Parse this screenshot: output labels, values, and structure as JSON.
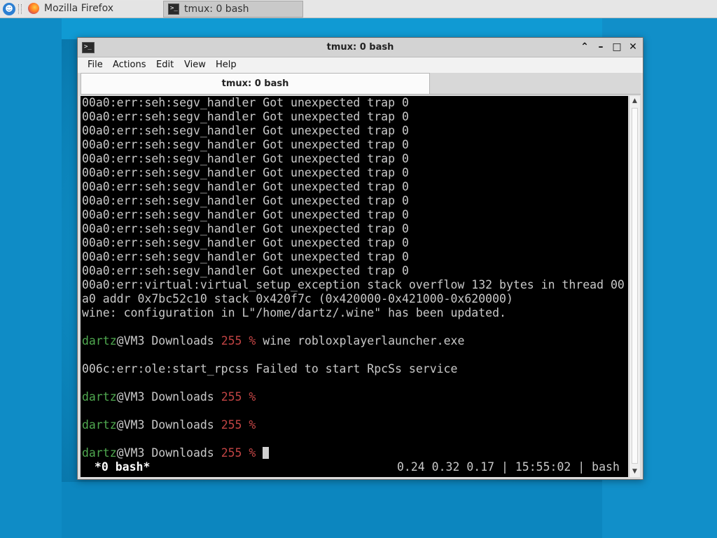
{
  "taskbar": {
    "tasks": [
      {
        "label": "Mozilla Firefox",
        "icon": "firefox-icon"
      },
      {
        "label": "tmux: 0 bash",
        "icon": "terminal-icon"
      }
    ]
  },
  "window": {
    "title": "tmux: 0 bash",
    "controls": [
      "maximize-up",
      "minimize",
      "maximize",
      "close"
    ],
    "menu": [
      "File",
      "Actions",
      "Edit",
      "View",
      "Help"
    ],
    "tab_label": "tmux: 0 bash"
  },
  "terminal": {
    "lines": [
      {
        "text": "00a0:err:seh:segv_handler Got unexpected trap 0"
      },
      {
        "text": "00a0:err:seh:segv_handler Got unexpected trap 0"
      },
      {
        "text": "00a0:err:seh:segv_handler Got unexpected trap 0"
      },
      {
        "text": "00a0:err:seh:segv_handler Got unexpected trap 0"
      },
      {
        "text": "00a0:err:seh:segv_handler Got unexpected trap 0"
      },
      {
        "text": "00a0:err:seh:segv_handler Got unexpected trap 0"
      },
      {
        "text": "00a0:err:seh:segv_handler Got unexpected trap 0"
      },
      {
        "text": "00a0:err:seh:segv_handler Got unexpected trap 0"
      },
      {
        "text": "00a0:err:seh:segv_handler Got unexpected trap 0"
      },
      {
        "text": "00a0:err:seh:segv_handler Got unexpected trap 0"
      },
      {
        "text": "00a0:err:seh:segv_handler Got unexpected trap 0"
      },
      {
        "text": "00a0:err:seh:segv_handler Got unexpected trap 0"
      },
      {
        "text": "00a0:err:seh:segv_handler Got unexpected trap 0"
      },
      {
        "text": "00a0:err:virtual:virtual_setup_exception stack overflow 132 bytes in thread 00"
      },
      {
        "text": "a0 addr 0x7bc52c10 stack 0x420f7c (0x420000-0x421000-0x620000)"
      },
      {
        "text": "wine: configuration in L\"/home/dartz/.wine\" has been updated."
      },
      {
        "text": ""
      },
      {
        "prompt": true,
        "user": "dartz",
        "host": "@VM3 Downloads ",
        "code": "255 %",
        "command": " wine robloxplayerlauncher.exe"
      },
      {
        "text": ""
      },
      {
        "text": "006c:err:ole:start_rpcss Failed to start RpcSs service"
      },
      {
        "text": ""
      },
      {
        "prompt": true,
        "user": "dartz",
        "host": "@VM3 Downloads ",
        "code": "255 %",
        "command": ""
      },
      {
        "text": ""
      },
      {
        "prompt": true,
        "user": "dartz",
        "host": "@VM3 Downloads ",
        "code": "255 %",
        "command": ""
      },
      {
        "text": ""
      },
      {
        "prompt": true,
        "user": "dartz",
        "host": "@VM3 Downloads ",
        "code": "255 %",
        "command": " ",
        "cursor": true
      }
    ],
    "status_left": " *0 bash*",
    "status_right": "0.24 0.32 0.17 | 15:55:02 | bash"
  },
  "colors": {
    "prompt_user": "#4fa84f",
    "prompt_code": "#c24444",
    "terminal_bg": "#000000",
    "terminal_fg": "#c9c9c9",
    "desktop": "#1aa7de"
  }
}
